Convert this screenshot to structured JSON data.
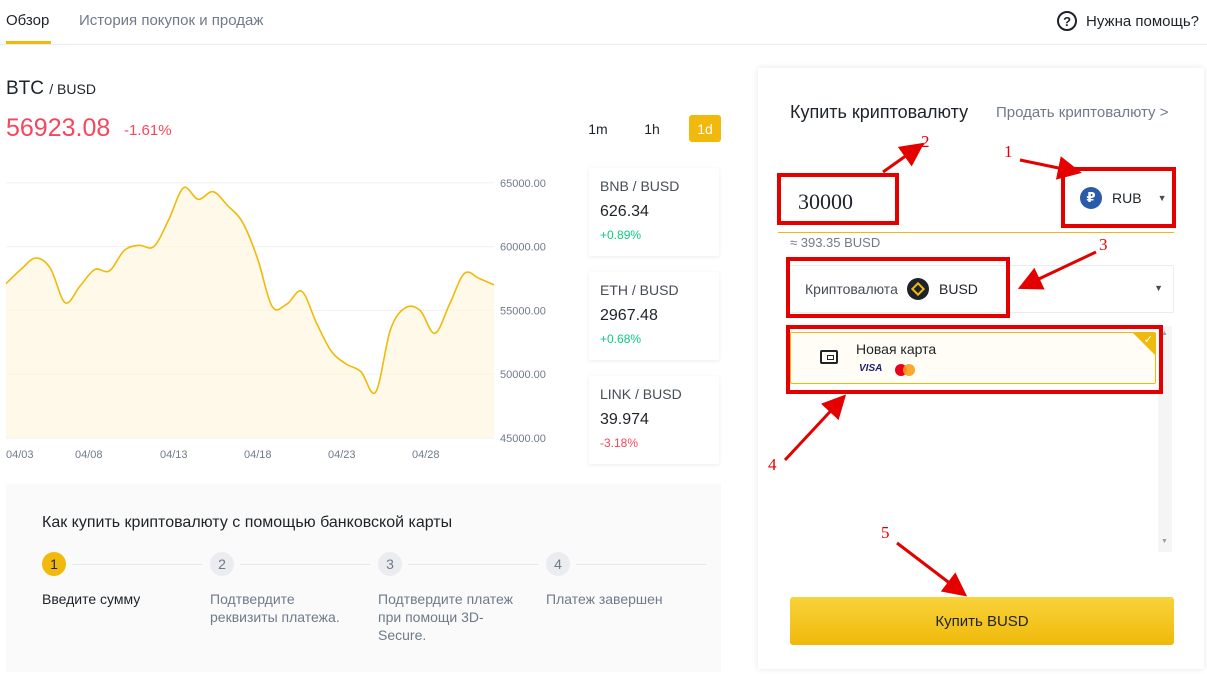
{
  "nav": {
    "tabs": [
      {
        "label": "Обзор"
      },
      {
        "label": "История покупок и продаж"
      }
    ],
    "help_label": "Нужна помощь?",
    "help_icon": "?"
  },
  "pair": {
    "base": "BTC",
    "quote": "/ BUSD",
    "price": "56923.08",
    "change": "-1.61%"
  },
  "timeframes": [
    {
      "label": "1m",
      "active": false
    },
    {
      "label": "1h",
      "active": false
    },
    {
      "label": "1d",
      "active": true
    }
  ],
  "chart_data": {
    "type": "area",
    "title": "",
    "xlabel": "",
    "ylabel": "",
    "ylim": [
      45000,
      66000
    ],
    "y_ticks": [
      "65000.00",
      "60000.00",
      "55000.00",
      "50000.00",
      "45000.00"
    ],
    "x_ticks": [
      "04/03",
      "04/08",
      "04/13",
      "04/18",
      "04/23",
      "04/28"
    ],
    "grid": true,
    "color": "#f0b90b",
    "series": [
      {
        "values": [
          [
            0,
            57100
          ],
          [
            1,
            58200
          ],
          [
            2,
            59100
          ],
          [
            3,
            58300
          ],
          [
            4,
            55600
          ],
          [
            5,
            56900
          ],
          [
            6,
            58200
          ],
          [
            7,
            58100
          ],
          [
            8,
            59700
          ],
          [
            9,
            60100
          ],
          [
            10,
            60000
          ],
          [
            11,
            62100
          ],
          [
            12,
            64600
          ],
          [
            13,
            63700
          ],
          [
            14,
            64300
          ],
          [
            15,
            63200
          ],
          [
            16,
            61900
          ],
          [
            17,
            59100
          ],
          [
            18,
            55300
          ],
          [
            19,
            55500
          ],
          [
            20,
            56500
          ],
          [
            21,
            54000
          ],
          [
            22,
            51800
          ],
          [
            23,
            50800
          ],
          [
            24,
            50200
          ],
          [
            25,
            48600
          ],
          [
            26,
            53500
          ],
          [
            27,
            55200
          ],
          [
            28,
            55000
          ],
          [
            29,
            53200
          ],
          [
            30,
            55500
          ],
          [
            31,
            57900
          ],
          [
            32,
            57500
          ],
          [
            33,
            57000
          ]
        ]
      }
    ]
  },
  "tickers": [
    {
      "pair": "BNB / BUSD",
      "price": "626.34",
      "change": "+0.89%",
      "dir": "up"
    },
    {
      "pair": "ETH / BUSD",
      "price": "2967.48",
      "change": "+0.68%",
      "dir": "up"
    },
    {
      "pair": "LINK / BUSD",
      "price": "39.974",
      "change": "-3.18%",
      "dir": "down"
    }
  ],
  "howto": {
    "title": "Как купить криптовалюту с помощью банковской карты",
    "steps": [
      {
        "num": "1",
        "label": "Введите сумму"
      },
      {
        "num": "2",
        "label": "Подтвердите реквизиты платежа."
      },
      {
        "num": "3",
        "label": "Подтвердите платеж при помощи 3D-Secure."
      },
      {
        "num": "4",
        "label": "Платеж завершен"
      }
    ]
  },
  "buy": {
    "title": "Купить криптовалюту",
    "sell_link": "Продать криптовалюту >",
    "amount": "30000",
    "fiat_icon": "₽",
    "fiat": "RUB",
    "approx": "≈ 393.35 BUSD",
    "crypto_label": "Криптовалюта",
    "crypto": "BUSD",
    "card_name": "Новая карта",
    "card_brand": "VISA",
    "button": "Купить BUSD"
  },
  "annotations": [
    "1",
    "2",
    "3",
    "4",
    "5"
  ],
  "colors": {
    "accent": "#f0b90b",
    "negative": "#f6465d",
    "positive": "#0ecb81",
    "annotation": "#e50000"
  }
}
